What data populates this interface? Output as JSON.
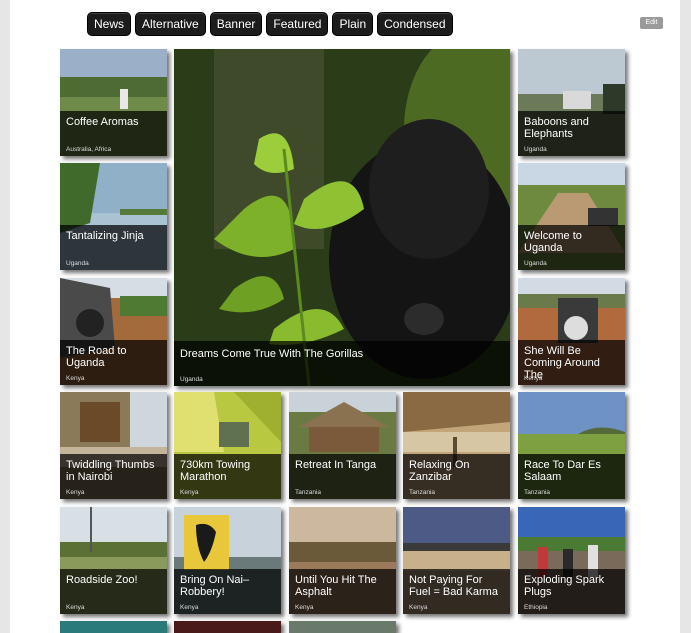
{
  "nav": {
    "tabs": [
      "News",
      "Alternative",
      "Banner",
      "Featured",
      "Plain",
      "Condensed"
    ],
    "edit_label": "Edit"
  },
  "featured": {
    "title": "Dreams Come True With The Gorillas",
    "location": "Uganda",
    "image": "gorilla-photo"
  },
  "tiles": [
    {
      "title": "Coffee Aromas",
      "location": "Australia, Africa",
      "image": "landscape-photo"
    },
    {
      "title": "Baboons and Elephants",
      "location": "Uganda",
      "image": "road-vehicles-photo"
    },
    {
      "title": "Tantalizing Jinja",
      "location": "Uganda",
      "image": "lake-photo"
    },
    {
      "title": "Welcome to Uganda",
      "location": "Uganda",
      "image": "road-motorbike-photo"
    },
    {
      "title": "The Road to Uganda",
      "location": "Kenya",
      "image": "motorbike-road-photo"
    },
    {
      "title": "She Will Be Coming Around The",
      "location": "Kenya",
      "image": "motorbike-village-photo"
    },
    {
      "title": "Twiddling Thumbs in Nairobi",
      "location": "Kenya",
      "image": "workshop-photo"
    },
    {
      "title": "730km Towing Marathon",
      "location": "Kenya",
      "image": "tent-photo"
    },
    {
      "title": "Retreat In Tanga",
      "location": "Tanzania",
      "image": "thatched-hut-photo"
    },
    {
      "title": "Relaxing On Zanzibar",
      "location": "Tanzania",
      "image": "beach-hut-photo"
    },
    {
      "title": "Race To Dar Es Salaam",
      "location": "Tanzania",
      "image": "plantation-photo"
    },
    {
      "title": "Roadside Zoo!",
      "location": "Kenya",
      "image": "savanna-photo"
    },
    {
      "title": "Bring On Nai–Robbery!",
      "location": "Kenya",
      "image": "equator-sign-photo"
    },
    {
      "title": "Until You Hit The Asphalt",
      "location": "Kenya",
      "image": "dirt-plain-photo"
    },
    {
      "title": "Not Paying For Fuel = Bad Karma",
      "location": "Kenya",
      "image": "road-sunset-photo"
    },
    {
      "title": "Exploding Spark Plugs",
      "location": "Ethiopia",
      "image": "crowd-photo"
    }
  ]
}
